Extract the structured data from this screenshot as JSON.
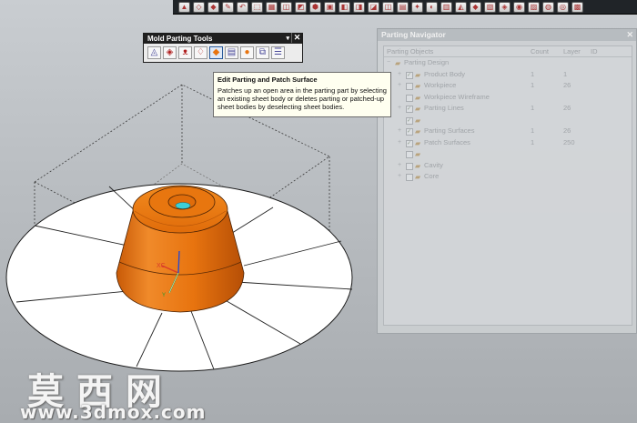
{
  "mold_tools": {
    "title": "Mold Parting Tools",
    "dropdown_glyph": "▾",
    "close_glyph": "✕",
    "buttons": [
      {
        "icon": "region-analysis-icon"
      },
      {
        "icon": "mold-design-validation-icon"
      },
      {
        "icon": "parting-check-icon"
      },
      {
        "icon": "define-region-icon"
      },
      {
        "icon": "edit-parting-patch-surface-icon"
      },
      {
        "icon": "design-parting-surface-icon"
      },
      {
        "icon": "define-cavity-core-icon"
      },
      {
        "icon": "swap-model-icon"
      },
      {
        "icon": "backup-parting-patch-icon"
      }
    ]
  },
  "tooltip": {
    "title": "Edit Parting and Patch Surface",
    "body": "Patches up an open area in the parting part by selecting an existing sheet body or deletes parting or patched-up sheet bodies by deselecting sheet bodies."
  },
  "navigator": {
    "title": "Parting Navigator",
    "columns": {
      "objects": "Parting Objects",
      "count": "Count",
      "layer": "Layer",
      "id": "ID"
    },
    "rows": [
      {
        "label": "Parting Design",
        "count": "",
        "layer": "",
        "depth": 0,
        "expand": "−",
        "checked": null
      },
      {
        "label": "Product Body",
        "count": "1",
        "layer": "1",
        "depth": 1,
        "expand": "+",
        "checked": true
      },
      {
        "label": "Workpiece",
        "count": "1",
        "layer": "26",
        "depth": 1,
        "expand": "+",
        "checked": false
      },
      {
        "label": "Workpiece Wireframe",
        "count": "",
        "layer": "",
        "depth": 1,
        "expand": "",
        "checked": false
      },
      {
        "label": "Parting Lines",
        "count": "1",
        "layer": "26",
        "depth": 1,
        "expand": "+",
        "checked": true
      },
      {
        "label": "",
        "count": "",
        "layer": "",
        "depth": 1,
        "expand": "",
        "checked": true,
        "faint": true
      },
      {
        "label": "Parting Surfaces",
        "count": "1",
        "layer": "26",
        "depth": 1,
        "expand": "+",
        "checked": true
      },
      {
        "label": "Patch Surfaces",
        "count": "1",
        "layer": "250",
        "depth": 1,
        "expand": "+",
        "checked": true
      },
      {
        "label": "",
        "count": "",
        "layer": "",
        "depth": 1,
        "expand": "",
        "checked": false,
        "faint": true
      },
      {
        "label": "Cavity",
        "count": "",
        "layer": "",
        "depth": 1,
        "expand": "+",
        "checked": false
      },
      {
        "label": "Core",
        "count": "",
        "layer": "",
        "depth": 1,
        "expand": "+",
        "checked": false
      }
    ]
  },
  "top_toolbar": {
    "button_count": 28
  },
  "scene": {
    "part_color": "#e8740f",
    "cap_hole_color": "#3cd0d8",
    "disc_color": "#ffffff",
    "axis_colors": {
      "x": "#d93a2a",
      "y": "#2c9a2c",
      "z": "#2a4ad0"
    }
  },
  "watermark": {
    "text": "莫西网",
    "url": "www.3dmox.com"
  }
}
